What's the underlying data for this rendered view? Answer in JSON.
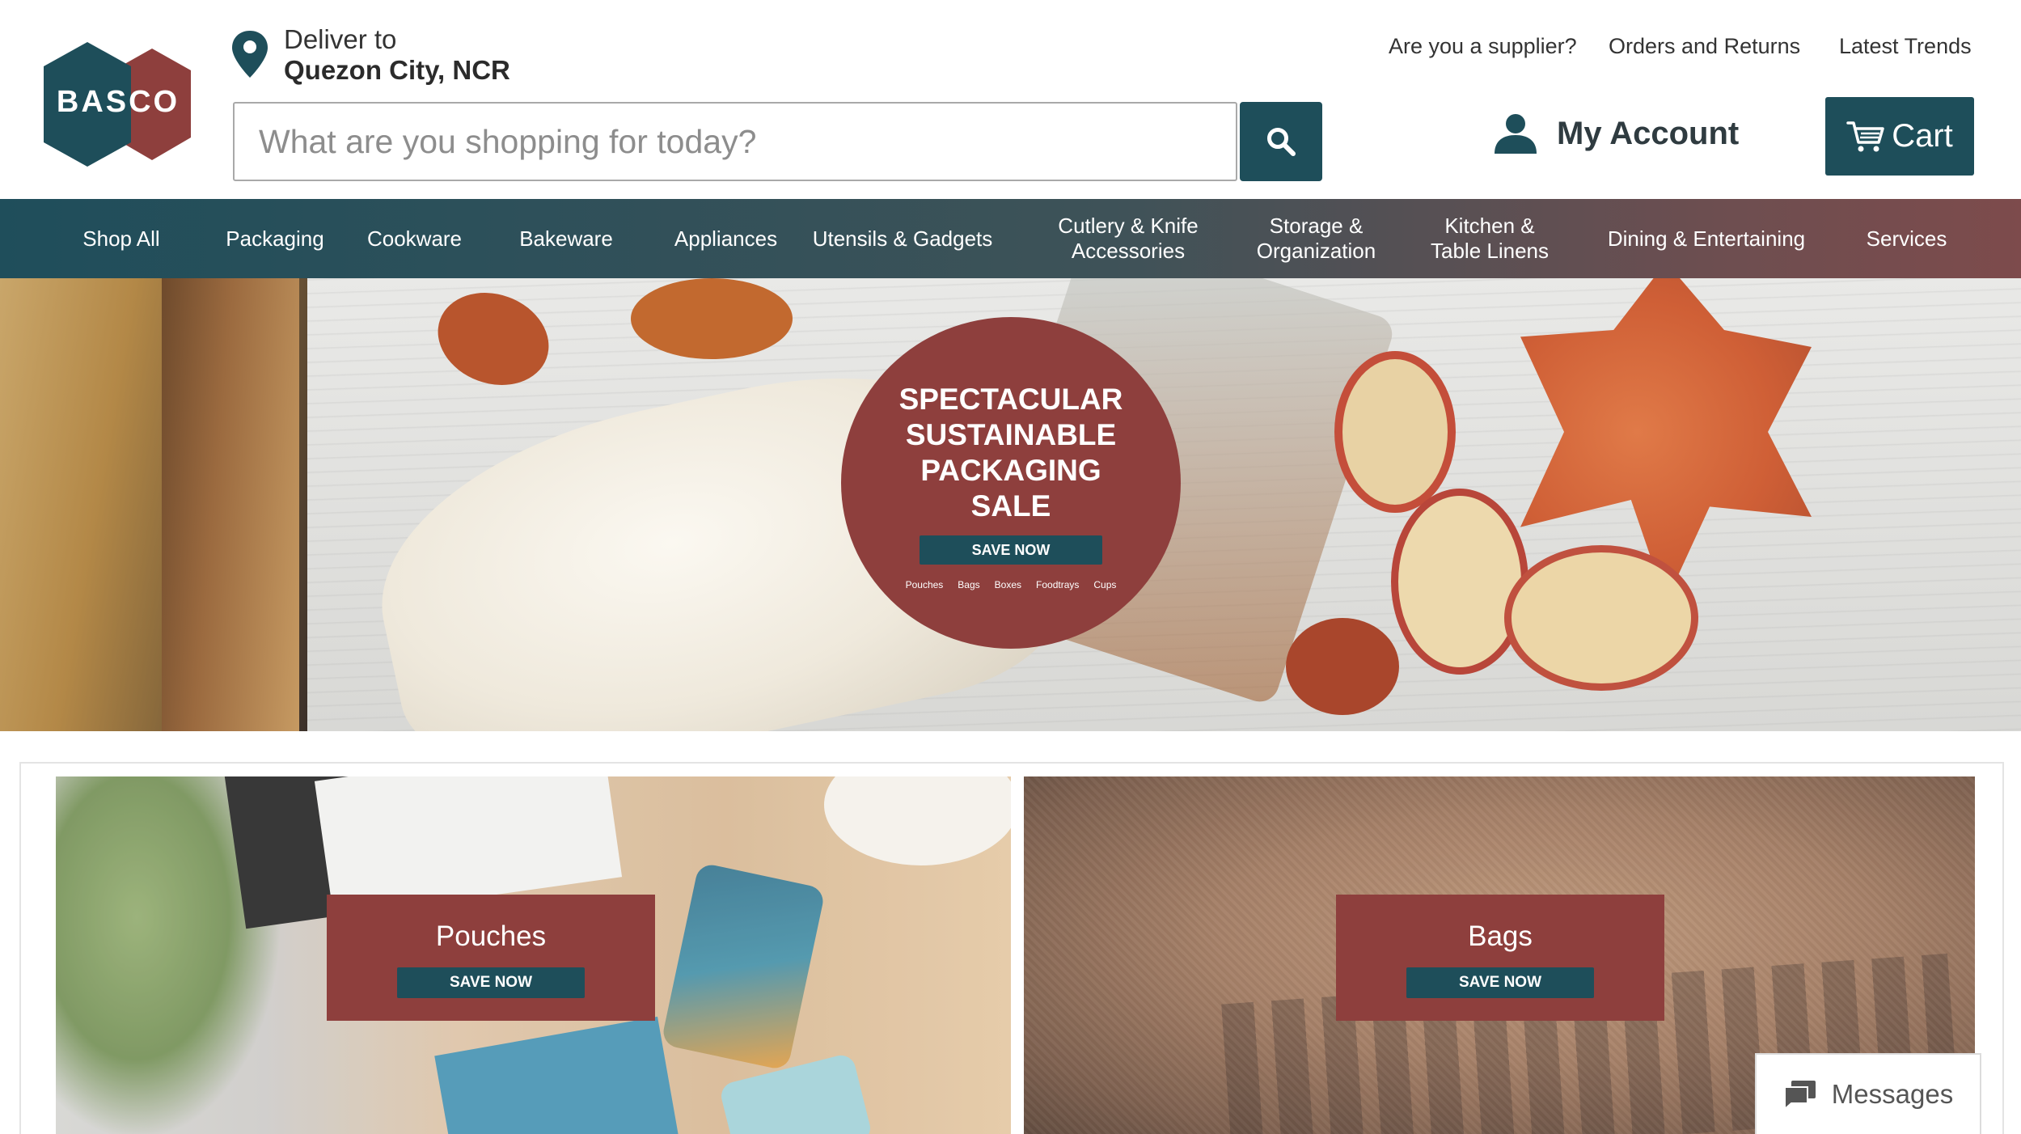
{
  "brand": {
    "logo_text": "BASCO",
    "primary_color": "#1e4e5a",
    "accent_color": "#8e3f3d"
  },
  "deliver": {
    "label": "Deliver to",
    "location": "Quezon City, NCR",
    "icon": "map-pin-icon"
  },
  "search": {
    "placeholder": "What are you shopping for today?",
    "value": "",
    "icon": "search-icon"
  },
  "top_links": [
    "Are you a supplier?",
    "Orders and Returns",
    "Latest Trends"
  ],
  "account": {
    "label": "My Account",
    "icon": "user-icon"
  },
  "cart": {
    "label": "Cart",
    "icon": "cart-icon"
  },
  "nav": {
    "items": [
      {
        "label": "Shop All"
      },
      {
        "label": "Packaging"
      },
      {
        "label": "Cookware"
      },
      {
        "label": "Bakeware"
      },
      {
        "label": "Appliances"
      },
      {
        "label": "Utensils & Gadgets"
      },
      {
        "label": "Cutlery & Knife\nAccessories"
      },
      {
        "label": "Storage &\nOrganization"
      },
      {
        "label": "Kitchen &\nTable Linens"
      },
      {
        "label": "Dining & Entertaining"
      },
      {
        "label": "Services"
      }
    ]
  },
  "hero": {
    "title": "SPECTACULAR SUSTAINABLE PACKAGING SALE",
    "button": "SAVE NOW",
    "categories": [
      "Pouches",
      "Bags",
      "Boxes",
      "Foodtrays",
      "Cups"
    ]
  },
  "tiles": [
    {
      "name": "Pouches",
      "button": "SAVE NOW"
    },
    {
      "name": "Bags",
      "button": "SAVE NOW"
    }
  ],
  "messages": {
    "label": "Messages",
    "icon": "chat-icon"
  }
}
